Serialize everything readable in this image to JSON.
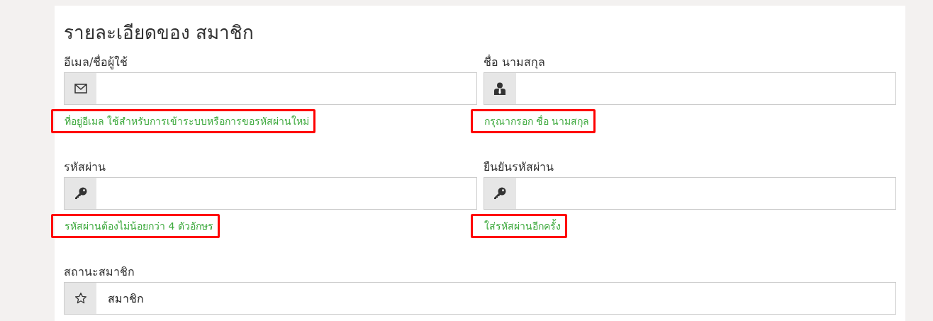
{
  "title": "รายละเอียดของ สมาชิก",
  "rows": [
    {
      "fields": [
        {
          "label": "อีเมล/ชื่อผู้ใช้",
          "kind": "email",
          "help": "ที่อยู่อีเมล ใช้สำหรับการเข้าระบบหรือการขอรหัสผ่านใหม่",
          "highlighted": true
        },
        {
          "label": "ชื่อ นามสกุล",
          "kind": "name",
          "help": "กรุณากรอก ชื่อ นามสกุล",
          "highlighted": true
        }
      ]
    },
    {
      "fields": [
        {
          "label": "รหัสผ่าน",
          "kind": "password",
          "help": "รหัสผ่านต้องไม่น้อยกว่า 4 ตัวอักษร",
          "highlighted": true
        },
        {
          "label": "ยืนยันรหัสผ่าน",
          "kind": "password",
          "help": "ใส่รหัสผ่านอีกครั้ง",
          "highlighted": true
        }
      ]
    },
    {
      "fields": [
        {
          "label": "สถานะสมาชิก",
          "kind": "status",
          "value": "สมาชิก"
        }
      ]
    }
  ]
}
